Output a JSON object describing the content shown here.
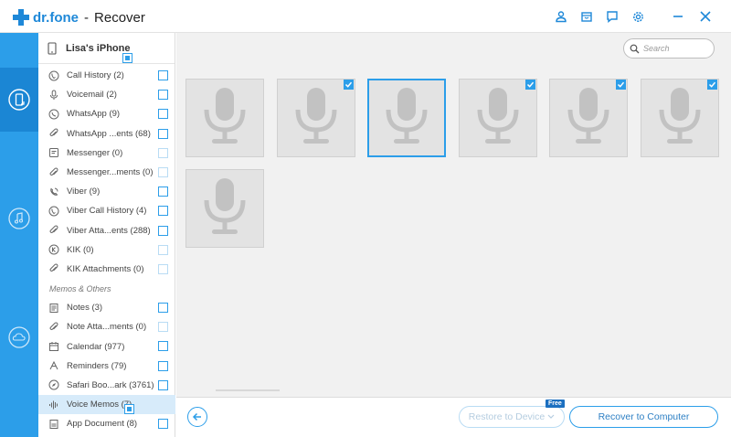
{
  "app": {
    "brand": "dr.fone",
    "separator": "-",
    "title": "Recover"
  },
  "title_icons": [
    "user-icon",
    "cart-icon",
    "feedback-icon",
    "settings-icon",
    "minimize-icon",
    "close-icon"
  ],
  "rail": {
    "items": [
      {
        "icon": "phone-recover-icon",
        "active": true
      },
      {
        "icon": "itunes-music-icon",
        "active": false
      },
      {
        "icon": "icloud-icon",
        "active": false
      }
    ]
  },
  "device": {
    "name": "Lisa's iPhone"
  },
  "categories": [
    {
      "label": "Call History (2)",
      "icon": "phone-icon",
      "checkbox": "normal"
    },
    {
      "label": "Voicemail (2)",
      "icon": "mic-icon",
      "checkbox": "normal"
    },
    {
      "label": "WhatsApp (9)",
      "icon": "whatsapp-icon",
      "checkbox": "normal"
    },
    {
      "label": "WhatsApp ...ents (68)",
      "icon": "attachment-icon",
      "checkbox": "normal"
    },
    {
      "label": "Messenger (0)",
      "icon": "messenger-icon",
      "checkbox": "dim"
    },
    {
      "label": "Messenger...ments (0)",
      "icon": "attachment-icon",
      "checkbox": "dim"
    },
    {
      "label": "Viber (9)",
      "icon": "viber-icon",
      "checkbox": "normal"
    },
    {
      "label": "Viber Call History (4)",
      "icon": "phone-icon",
      "checkbox": "normal"
    },
    {
      "label": "Viber Atta...ents (288)",
      "icon": "attachment-icon",
      "checkbox": "normal"
    },
    {
      "label": "KIK (0)",
      "icon": "kik-icon",
      "checkbox": "dim"
    },
    {
      "label": "KIK Attachments (0)",
      "icon": "attachment-icon",
      "checkbox": "dim"
    }
  ],
  "section_memos": "Memos & Others",
  "memo_categories": [
    {
      "label": "Notes (3)",
      "icon": "notes-icon",
      "checkbox": "normal"
    },
    {
      "label": "Note Atta...ments (0)",
      "icon": "attachment-icon",
      "checkbox": "dim"
    },
    {
      "label": "Calendar (977)",
      "icon": "calendar-icon",
      "checkbox": "normal"
    },
    {
      "label": "Reminders (79)",
      "icon": "reminders-icon",
      "checkbox": "normal"
    },
    {
      "label": "Safari Boo...ark (3761)",
      "icon": "compass-icon",
      "checkbox": "normal"
    },
    {
      "label": "Voice Memos (7)",
      "icon": "waveform-icon",
      "checkbox": "checked",
      "selected": true
    },
    {
      "label": "App Document (8)",
      "icon": "document-icon",
      "checkbox": "normal"
    }
  ],
  "search": {
    "placeholder": "Search"
  },
  "tiles": [
    {
      "checked": false,
      "focused": false
    },
    {
      "checked": true,
      "focused": false
    },
    {
      "checked": false,
      "focused": true
    },
    {
      "checked": true,
      "focused": false
    },
    {
      "checked": true,
      "focused": false
    },
    {
      "checked": true,
      "focused": false
    },
    {
      "checked": false,
      "focused": false
    }
  ],
  "bottom": {
    "restore_label": "Restore to Device",
    "free_badge": "Free",
    "recover_label": "Recover to Computer"
  },
  "colors": {
    "accent": "#2c9ee9",
    "rail": "#2c9ee9",
    "rail_active": "#1b86d4",
    "selected_row": "#d7ebfa"
  }
}
